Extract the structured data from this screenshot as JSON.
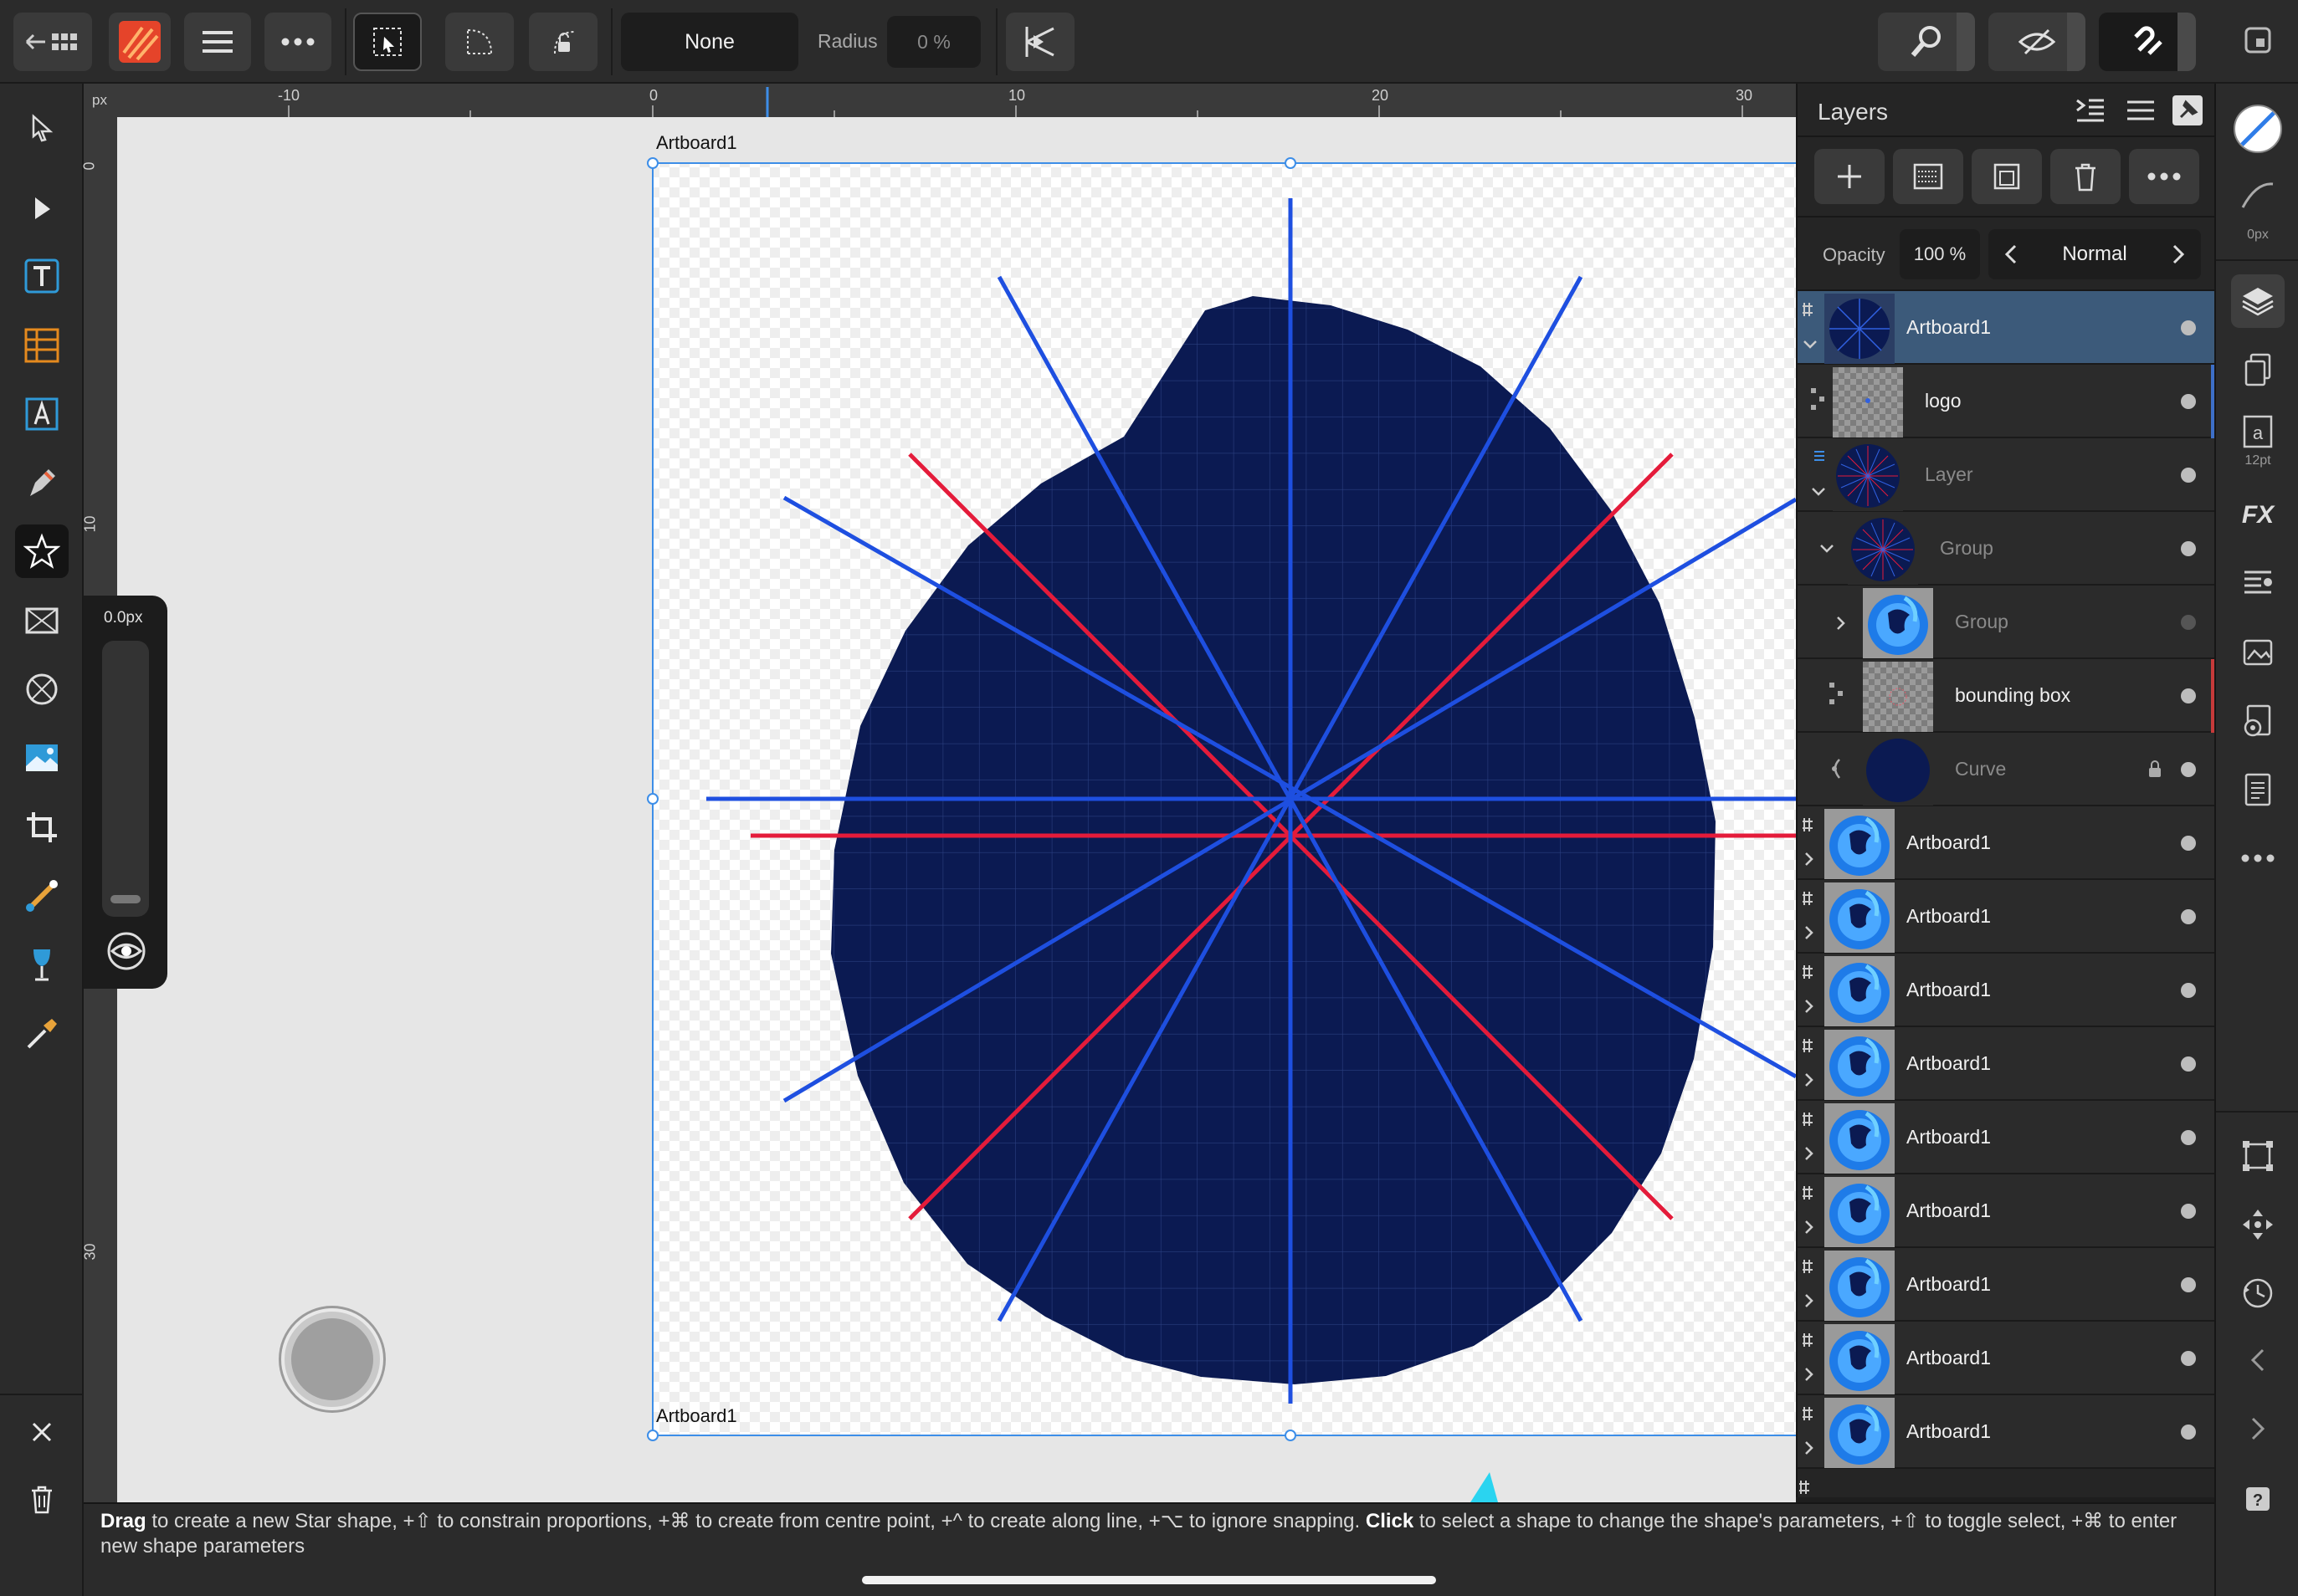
{
  "toolbar": {
    "back_icon": "back-grid-icon",
    "app_icon": "designer-persona-icon",
    "menu_icon": "hamburger-icon",
    "more_icon": "ellipsis-icon",
    "corner_value": "None",
    "radius_label": "Radius",
    "radius_value": "0 %"
  },
  "ruler": {
    "unit": "px",
    "top_ticks": [
      "-10",
      "0",
      "10",
      "20",
      "30"
    ],
    "left_ticks": [
      "0",
      "10",
      "30"
    ]
  },
  "canvas": {
    "artboard_label_top": "Artboard1",
    "artboard_label_bottom": "Artboard1",
    "shape_fill": "#0b1a52",
    "line_blue": "#1e4fe0",
    "line_red": "#e41b3a"
  },
  "context_panel": {
    "value": "0.0px"
  },
  "layers": {
    "title": "Layers",
    "opacity_label": "Opacity",
    "opacity_value": "100 %",
    "blend_mode": "Normal",
    "rows": [
      {
        "name": "Artboard1",
        "dim": false,
        "selected": true
      },
      {
        "name": "logo",
        "dim": false,
        "selected": false
      },
      {
        "name": "Layer",
        "dim": true,
        "selected": false
      },
      {
        "name": "Group",
        "dim": true,
        "selected": false
      },
      {
        "name": "Group",
        "dim": true,
        "selected": false
      },
      {
        "name": "bounding box",
        "dim": false,
        "selected": false
      },
      {
        "name": "Curve",
        "dim": true,
        "selected": false
      },
      {
        "name": "Artboard1",
        "dim": false,
        "selected": false
      },
      {
        "name": "Artboard1",
        "dim": false,
        "selected": false
      },
      {
        "name": "Artboard1",
        "dim": false,
        "selected": false
      },
      {
        "name": "Artboard1",
        "dim": false,
        "selected": false
      },
      {
        "name": "Artboard1",
        "dim": false,
        "selected": false
      },
      {
        "name": "Artboard1",
        "dim": false,
        "selected": false
      },
      {
        "name": "Artboard1",
        "dim": false,
        "selected": false
      },
      {
        "name": "Artboard1",
        "dim": false,
        "selected": false
      },
      {
        "name": "Artboard1",
        "dim": false,
        "selected": false
      }
    ]
  },
  "right_rail": {
    "stroke_width": "0px",
    "font_size": "12pt",
    "fx_label": "FX"
  },
  "status": {
    "drag": "Drag",
    "text1": " to create a new Star shape, +⇧ to constrain proportions, +⌘ to create from centre point, +^ to create along line, +⌥ to ignore snapping. ",
    "click": "Click",
    "text2": " to select a shape to change the shape's parameters, +⇧ to toggle select, +⌘ to enter new shape parameters"
  }
}
